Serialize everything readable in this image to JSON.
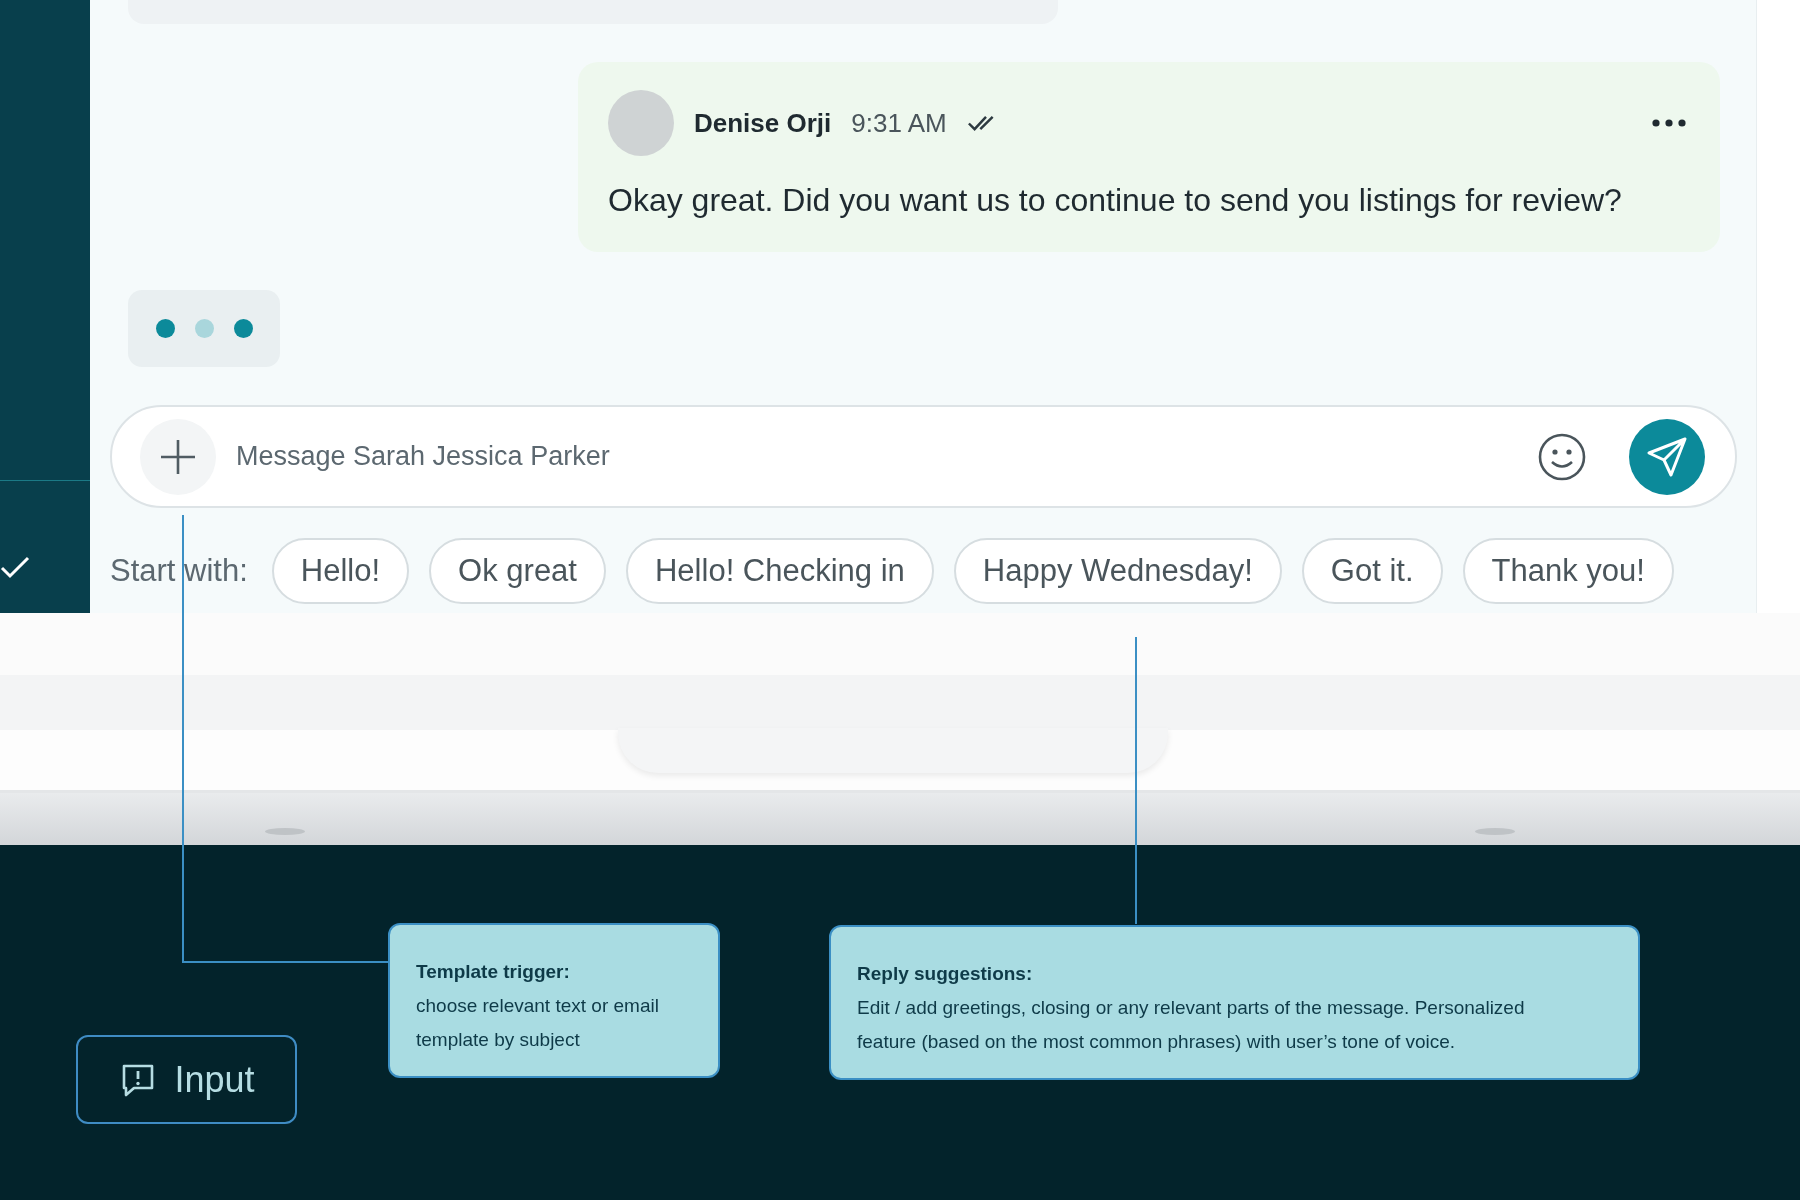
{
  "chat": {
    "messages": [
      {
        "author": "Denise Orji",
        "time": "9:31 AM",
        "read": true,
        "text": "Okay great. Did you want us to continue to send you listings for review?"
      }
    ],
    "typing": true,
    "composer": {
      "placeholder": "Message Sarah Jessica Parker"
    },
    "suggestions": {
      "label": "Start with:",
      "chips": [
        "Hello!",
        "Ok great",
        "Hello! Checking in",
        "Happy Wednesday!",
        "Got it.",
        "Thank you!"
      ]
    }
  },
  "annotations": [
    {
      "title": "Template trigger:",
      "text": "choose relevant text or email template by subject"
    },
    {
      "title": "Reply suggestions:",
      "text": "Edit / add greetings, closing or any relevant parts of the message. Personalized feature (based on the most common phrases) with user’s tone of voice."
    }
  ],
  "section_tag": {
    "label": "Input"
  }
}
